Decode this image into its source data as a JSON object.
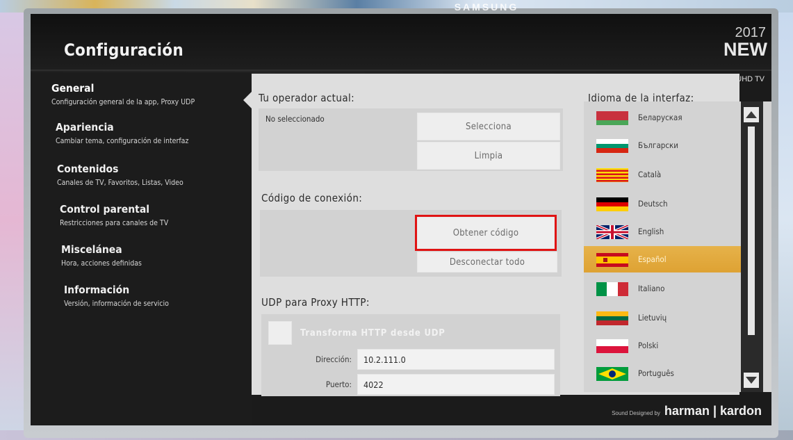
{
  "app": {
    "title": "Configuración"
  },
  "badge": {
    "year": "2017",
    "new": "NEW",
    "uhd": "UHD TV"
  },
  "brand": {
    "footer_small": "Sound Designed by",
    "footer": "harman | kardon",
    "tv_maker": "SAMSUNG"
  },
  "sidebar": {
    "items": [
      {
        "label": "General",
        "desc": "Configuración general de la app, Proxy UDP"
      },
      {
        "label": "Apariencia",
        "desc": "Cambiar tema, configuración de interfaz"
      },
      {
        "label": "Contenidos",
        "desc": "Canales de TV, Favoritos, Listas, Video"
      },
      {
        "label": "Control parental",
        "desc": "Restricciones para canales de TV"
      },
      {
        "label": "Miscelánea",
        "desc": "Hora, acciones definidas"
      },
      {
        "label": "Información",
        "desc": "Versión, información de servicio"
      }
    ]
  },
  "operator": {
    "title": "Tu operador actual:",
    "status": "No seleccionado",
    "select_button": "Selecciona",
    "clear_button": "Limpia"
  },
  "connection": {
    "title": "Código de conexión:",
    "get_code_button": "Obtener código",
    "disconnect_button": "Desconectar todo"
  },
  "udp_proxy": {
    "title": "UDP para Proxy HTTP:",
    "checkbox_label": "Transforma HTTP desde UDP",
    "address_label": "Dirección:",
    "address_value": "10.2.111.0",
    "port_label": "Puerto:",
    "port_value": "4022"
  },
  "language": {
    "title": "Idioma de la interfaz:",
    "items": [
      {
        "name": "Беларуская",
        "flag": "by-flag"
      },
      {
        "name": "Български",
        "flag": "bg-flag"
      },
      {
        "name": "Català",
        "flag": "cat-flag"
      },
      {
        "name": "Deutsch",
        "flag": "de-flag"
      },
      {
        "name": "English",
        "flag": "gb-flag"
      },
      {
        "name": "Español",
        "flag": "es-flag",
        "selected": true
      },
      {
        "name": "Italiano",
        "flag": "it-flag"
      },
      {
        "name": "Lietuvių",
        "flag": "lt-flag"
      },
      {
        "name": "Polski",
        "flag": "pl-flag"
      },
      {
        "name": "Português",
        "flag": "br-flag"
      }
    ]
  },
  "colors": {
    "highlight_outline": "#e01313",
    "selected_language": "#e0a53a"
  }
}
